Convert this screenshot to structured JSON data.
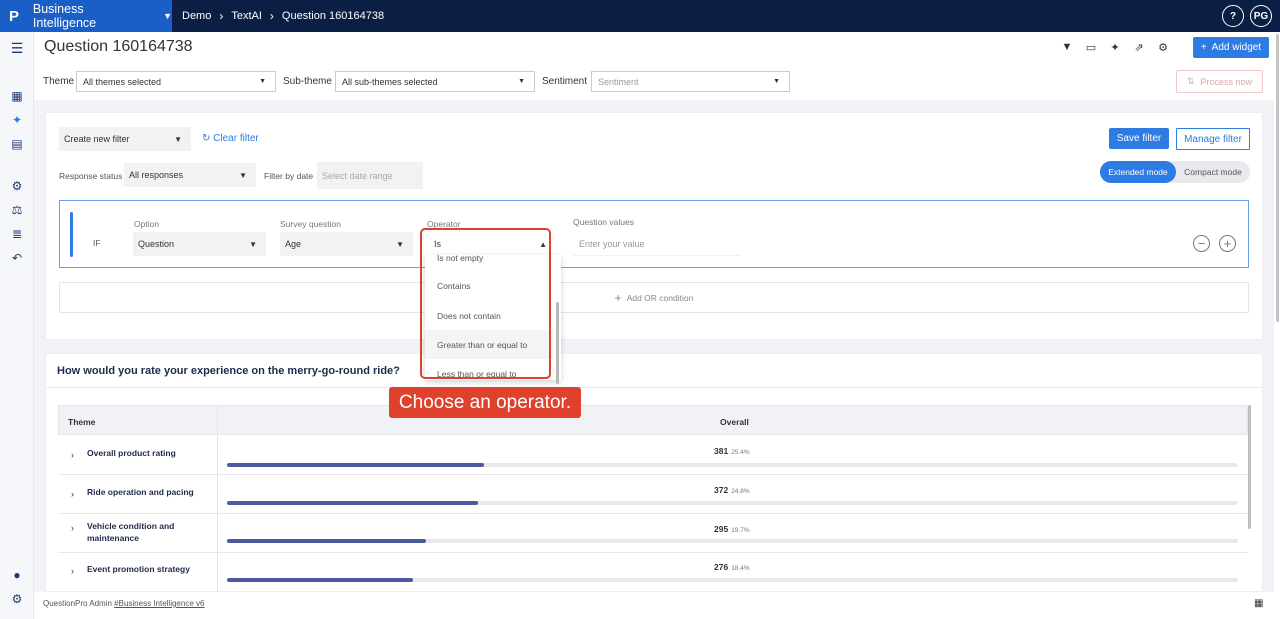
{
  "topbar": {
    "logo": "P",
    "app_name": "Business Intelligence",
    "breadcrumbs": [
      "Demo",
      "TextAI",
      "Question 160164738"
    ],
    "help_label": "?",
    "avatar_initials": "PG"
  },
  "header": {
    "title": "Question 160164738",
    "add_widget_label": "Add widget"
  },
  "theme_filters": {
    "theme_label": "Theme",
    "theme_value": "All themes selected",
    "subtheme_label": "Sub-theme",
    "subtheme_value": "All sub-themes selected",
    "sentiment_label": "Sentiment",
    "sentiment_placeholder": "Sentiment",
    "process_now_label": "Process now"
  },
  "filter_panel": {
    "create_filter_value": "Create new filter",
    "clear_filter_label": "Clear filter",
    "save_filter_label": "Save filter",
    "manage_filter_label": "Manage filter",
    "response_status_label": "Response status",
    "response_status_value": "All responses",
    "filter_by_date_label": "Filter by date",
    "date_placeholder": "Select date range",
    "mode_extended": "Extended mode",
    "mode_compact": "Compact mode",
    "condition": {
      "if_label": "IF",
      "option_label": "Option",
      "option_value": "Question",
      "survey_question_label": "Survey question",
      "survey_question_value": "Age",
      "operator_label": "Operator",
      "operator_value": "Is",
      "question_values_label": "Question values",
      "question_values_placeholder": "Enter your value"
    },
    "operator_options": [
      "Is not empty",
      "Contains",
      "Does not contain",
      "Greater than or equal to",
      "Less than or equal to"
    ],
    "add_or_label": "Add OR condition"
  },
  "callout": {
    "text": "Choose an operator."
  },
  "results": {
    "title": "How would you rate your experience on the merry-go-round ride?",
    "col_theme": "Theme",
    "col_overall": "Overall",
    "rows": [
      {
        "label": "Overall product rating",
        "count": "381",
        "pct": "25.4%",
        "fraction": 0.254
      },
      {
        "label": "Ride operation and pacing",
        "count": "372",
        "pct": "24.8%",
        "fraction": 0.248
      },
      {
        "label": "Vehicle condition and maintenance",
        "count": "295",
        "pct": "19.7%",
        "fraction": 0.197
      },
      {
        "label": "Event promotion strategy",
        "count": "276",
        "pct": "18.4%",
        "fraction": 0.184
      }
    ]
  },
  "footer": {
    "text": "QuestionPro Admin",
    "link": "#Business Intelligence v6"
  },
  "colors": {
    "topbar": "#0b1f45",
    "brand": "#1a5fc8",
    "accent": "#2d7be3",
    "highlight": "#e0412c",
    "bar_fill": "#4a5a9c"
  }
}
